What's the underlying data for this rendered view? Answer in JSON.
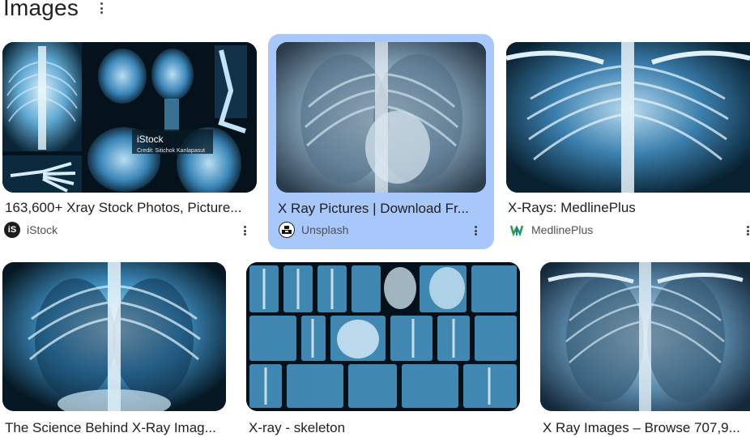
{
  "header": {
    "title": "Images"
  },
  "results": [
    {
      "caption": "163,600+ Xray Stock Photos, Picture...",
      "source": "iStock",
      "icon": "istock-logo-icon",
      "watermark": "iStock",
      "credit": "Credit: Sitichok Kanlapasut"
    },
    {
      "caption": "X Ray Pictures | Download Fr...",
      "source": "Unsplash",
      "icon": "unsplash-logo-icon"
    },
    {
      "caption": "X-Rays: MedlinePlus",
      "source": "MedlinePlus",
      "icon": "medlineplus-logo-icon"
    },
    {
      "caption": "The Science Behind X-Ray Imag..."
    },
    {
      "caption": "X-ray - skeleton"
    },
    {
      "caption": "X Ray Images – Browse 707,9..."
    }
  ],
  "colors": {
    "selected": "#a8c7fa",
    "xray_dark": "#0a1a26",
    "xray_light": "#cfe6f5"
  }
}
